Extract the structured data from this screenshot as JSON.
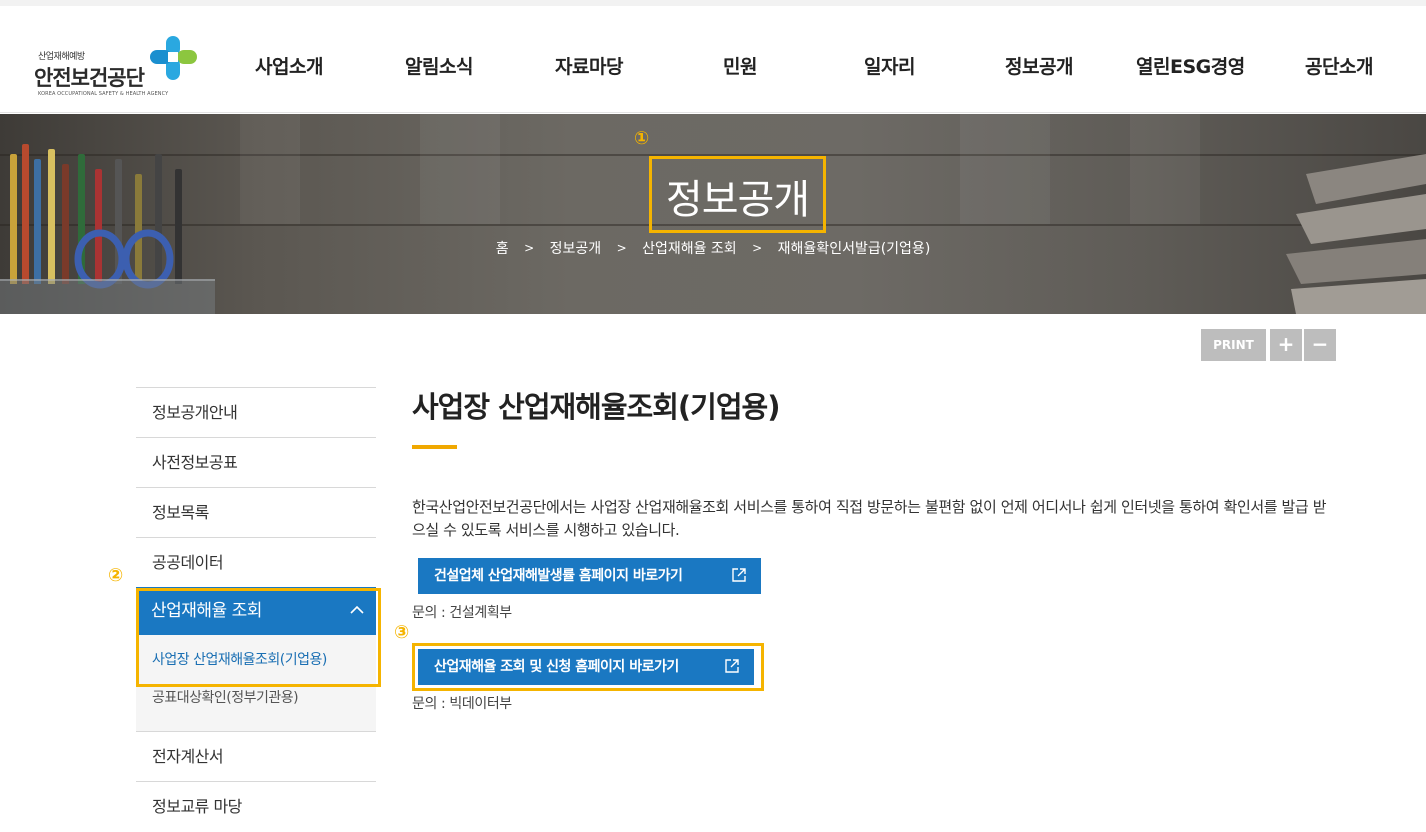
{
  "header": {
    "logo": {
      "small": "산업재해예방",
      "main": "안전보건공단",
      "eng": "KOREA OCCUPATIONAL SAFETY & HEALTH AGENCY"
    },
    "nav": [
      "사업소개",
      "알림소식",
      "자료마당",
      "민원",
      "일자리",
      "정보공개",
      "열린ESG경영",
      "공단소개"
    ]
  },
  "hero": {
    "marker": "①",
    "title": "정보공개",
    "breadcrumb": [
      "홈",
      "정보공개",
      "산업재해율 조회",
      "재해율확인서발급(기업용)"
    ],
    "separator": ">"
  },
  "utility": {
    "print": "PRINT",
    "zoom_in": "+",
    "zoom_out": "−"
  },
  "lnb": {
    "marker": "②",
    "items_before": [
      "정보공개안내",
      "사전정보공표",
      "정보목록",
      "공공데이터"
    ],
    "active": "산업재해율 조회",
    "sub": [
      "사업장 산업재해율조회(기업용)",
      "공표대상확인(정부기관용)"
    ],
    "items_after": [
      "전자계산서",
      "정보교류 마당"
    ]
  },
  "content": {
    "title": "사업장 산업재해율조회(기업용)",
    "intro": "한국산업안전보건공단에서는 사업장 산업재해율조회 서비스를 통하여 직접 방문하는 불편함 없이 언제 어디서나 쉽게 인터넷을 통하여 확인서를 발급 받으실 수 있도록 서비스를 시행하고 있습니다.",
    "button1": "건설업체 산업재해발생률 홈페이지 바로가기",
    "inquiry1": "문의 : 건설계획부",
    "marker3": "③",
    "button2": "산업재해율 조회 및 신청 홈페이지 바로가기",
    "inquiry2": "문의 : 빅데이터부"
  },
  "colors": {
    "primary": "#1a78c2",
    "highlight": "#f5b400",
    "accent_bar": "#f0a800",
    "utility_gray": "#bdbdbd"
  }
}
